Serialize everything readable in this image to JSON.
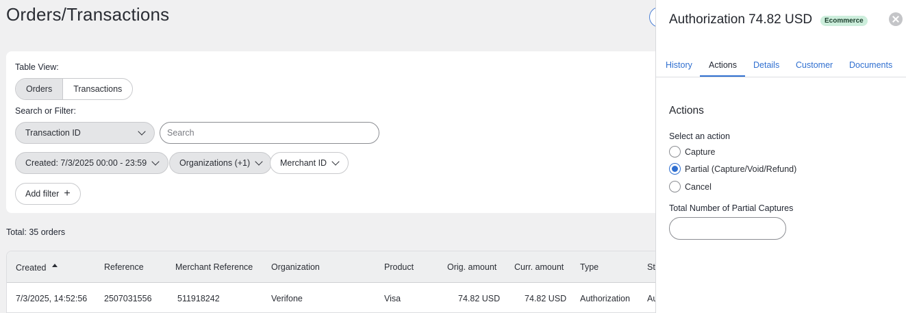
{
  "page": {
    "title": "Orders/Transactions"
  },
  "filters": {
    "table_view_label": "Table View:",
    "view_options": [
      "Orders",
      "Transactions"
    ],
    "search_label": "Search or Filter:",
    "field_select": "Transaction ID",
    "search_placeholder": "Search",
    "created_filter": "Created: 7/3/2025 00:00 - 23:59",
    "org_filter": "Organizations (+1)",
    "merchant_filter": "Merchant ID",
    "add_filter": "Add filter",
    "add_icon": "+"
  },
  "total": "Total: 35 orders",
  "table": {
    "columns": [
      "Created",
      "Reference",
      "Merchant Reference",
      "Organization",
      "Product",
      "Orig. amount",
      "Curr. amount",
      "Type",
      "St"
    ],
    "rows": [
      [
        "7/3/2025, 14:52:56",
        "2507031556",
        "511918242",
        "Verifone",
        "Visa",
        "74.82 USD",
        "74.82 USD",
        "Authorization",
        "Au"
      ]
    ]
  },
  "panel": {
    "title": "Authorization 74.82 USD",
    "badge": "Ecommerce",
    "tabs": [
      "History",
      "Actions",
      "Details",
      "Customer",
      "Documents"
    ],
    "active_tab": "Actions",
    "section_title": "Actions",
    "select_label": "Select an action",
    "options": [
      "Capture",
      "Partial (Capture/Void/Refund)",
      "Cancel"
    ],
    "selected_option": "Partial (Capture/Void/Refund)",
    "partial_label": "Total Number of Partial Captures",
    "partial_value": ""
  },
  "colors": {
    "accent": "#2f6fd0",
    "badge_bg": "#cdeedc"
  }
}
